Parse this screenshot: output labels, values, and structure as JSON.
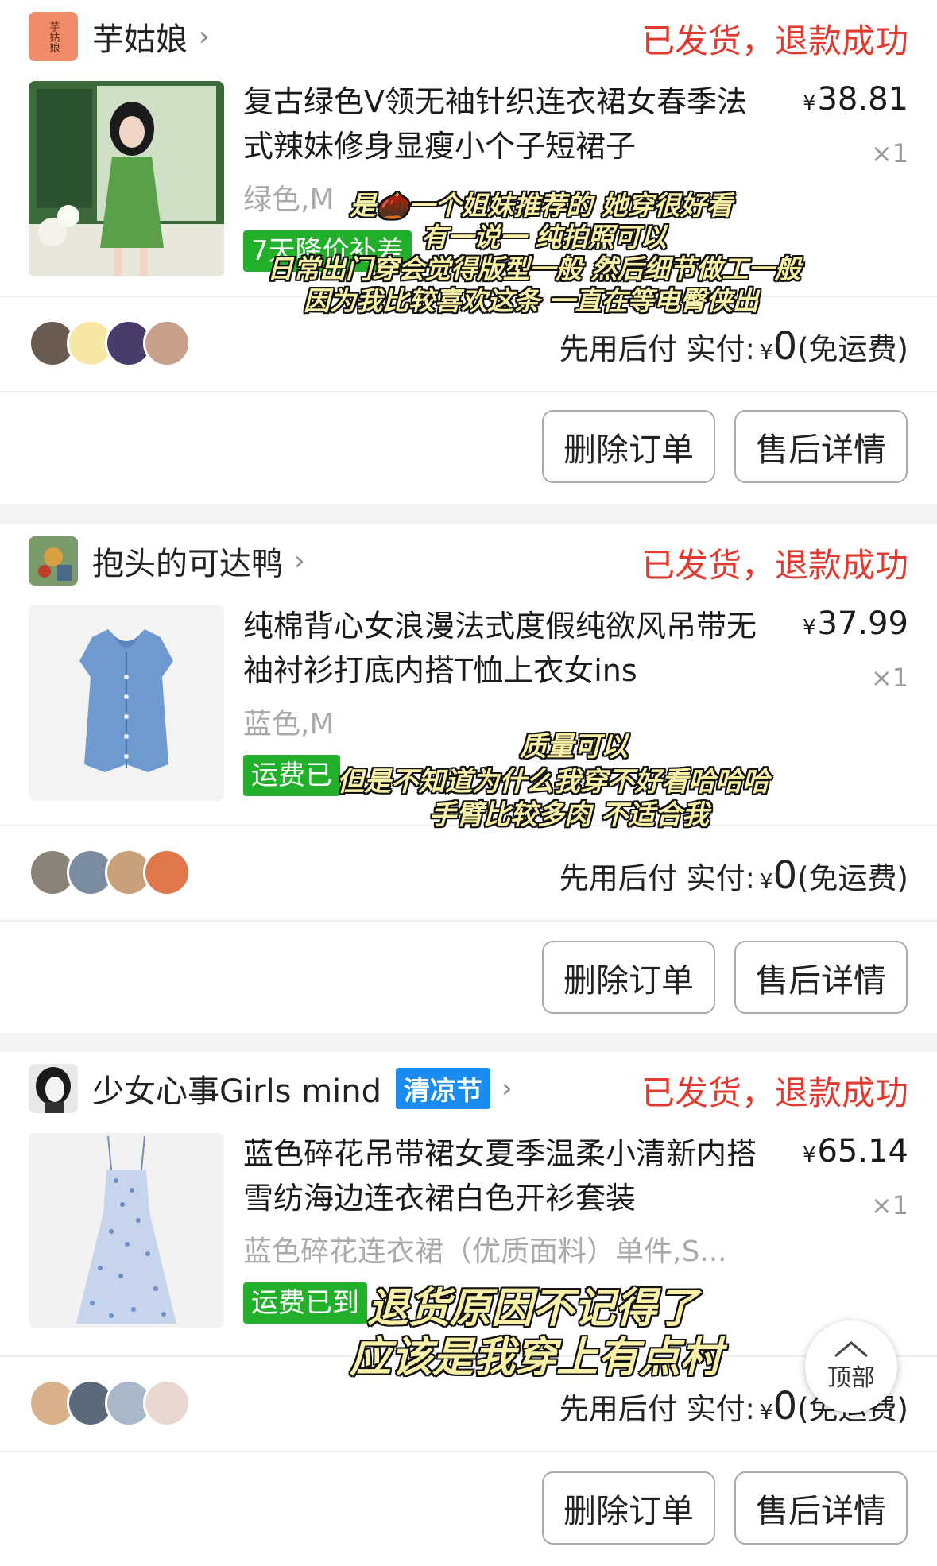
{
  "orders": [
    {
      "shop_name": "芋姑娘",
      "shop_logo_text": "芋姑娘",
      "status": "已发货，退款成功",
      "title": "复古绿色V领无袖针织连衣裙女春季法式辣妹修身显瘦小个子短裙子",
      "price_symbol": "¥",
      "price": "38.81",
      "qty": "×1",
      "sku": "绿色,M",
      "tag": "7天降价补差",
      "pay_label": "先用后付 实付:",
      "pay_symbol": "¥",
      "pay_amount": "0",
      "pay_note": "(免运费)",
      "delete_label": "删除订单",
      "service_label": "售后详情",
      "captions": [
        "是🌰一个姐妹推荐的 她穿很好看",
        "有一说一 纯拍照可以",
        "日常出门穿会觉得版型一般 然后细节做工一般",
        "因为我比较喜欢这条 一直在等电臀侠出"
      ]
    },
    {
      "shop_name": "抱头的可达鸭",
      "status": "已发货，退款成功",
      "title": "纯棉背心女浪漫法式度假纯欲风吊带无袖衬衫打底内搭T恤上衣女ins",
      "price_symbol": "¥",
      "price": "37.99",
      "qty": "×1",
      "sku": "蓝色,M",
      "tag": "运费已",
      "pay_label": "先用后付 实付:",
      "pay_symbol": "¥",
      "pay_amount": "0",
      "pay_note": "(免运费)",
      "delete_label": "删除订单",
      "service_label": "售后详情",
      "captions": [
        "质量可以",
        "但是不知道为什么我穿不好看哈哈哈",
        "手臂比较多肉 不适合我"
      ]
    },
    {
      "shop_name": "少女心事Girls mind",
      "promo_badge": "清凉节",
      "status": "已发货，退款成功",
      "title": "蓝色碎花吊带裙女夏季温柔小清新内搭雪纺海边连衣裙白色开衫套装",
      "price_symbol": "¥",
      "price": "65.14",
      "qty": "×1",
      "sku": "蓝色碎花连衣裙（优质面料）单件,S...",
      "tag": "运费已到",
      "pay_label": "先用后付 实付:",
      "pay_symbol": "¥",
      "pay_amount": "0",
      "pay_note": "(免运费)",
      "delete_label": "删除订单",
      "service_label": "售后详情",
      "captions": [
        "退货原因不记得了",
        "应该是我穿上有点村"
      ]
    }
  ],
  "back_to_top_label": "顶部",
  "colors": {
    "status_red": "#e33a2f",
    "tag_green": "#22b02a",
    "badge_blue": "#1a8bf0",
    "caption_yellow": "#f7f0a6"
  }
}
